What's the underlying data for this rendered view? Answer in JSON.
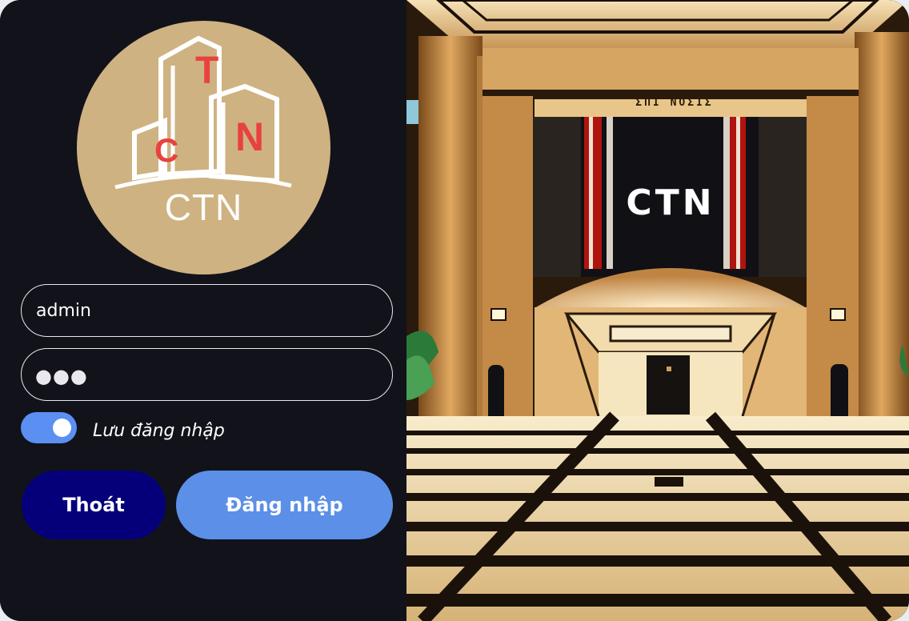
{
  "brand": {
    "logo_letters": [
      "C",
      "T",
      "N"
    ],
    "logo_name": "CTN",
    "logo_bg_color": "#cfb281",
    "logo_letter_color": "#e8423f"
  },
  "login": {
    "username_value": "admin",
    "password_mask": "●●●",
    "remember_label": "Lưu đăng nhập",
    "remember_checked": true,
    "exit_label": "Thoát",
    "login_label": "Đăng nhập"
  },
  "colors": {
    "panel_bg": "#12121a",
    "toggle_on": "#5b8ff1",
    "exit_btn": "#05007a",
    "login_btn": "#5b8fe8"
  },
  "hero": {
    "sign_text": "CTN",
    "plaque_text": "ΣΠΙ NOΣIΣ"
  }
}
